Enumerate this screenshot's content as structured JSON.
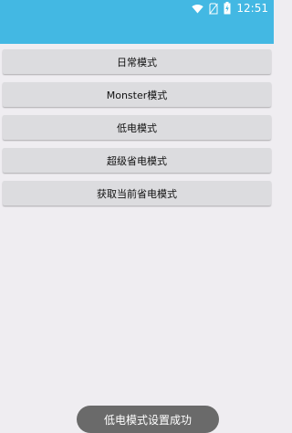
{
  "status_bar": {
    "time": "12:51",
    "icons": [
      "wifi-icon",
      "no-sim-icon",
      "battery-charging-icon"
    ],
    "color": "#43b8e3"
  },
  "buttons": [
    {
      "label": "日常模式",
      "name": "daily-mode-button"
    },
    {
      "label": "Monster模式",
      "name": "monster-mode-button"
    },
    {
      "label": "低电模式",
      "name": "low-power-mode-button"
    },
    {
      "label": "超级省电模式",
      "name": "super-power-saving-mode-button"
    },
    {
      "label": "获取当前省电模式",
      "name": "get-current-mode-button"
    }
  ],
  "toast": {
    "message": "低电模式设置成功"
  }
}
